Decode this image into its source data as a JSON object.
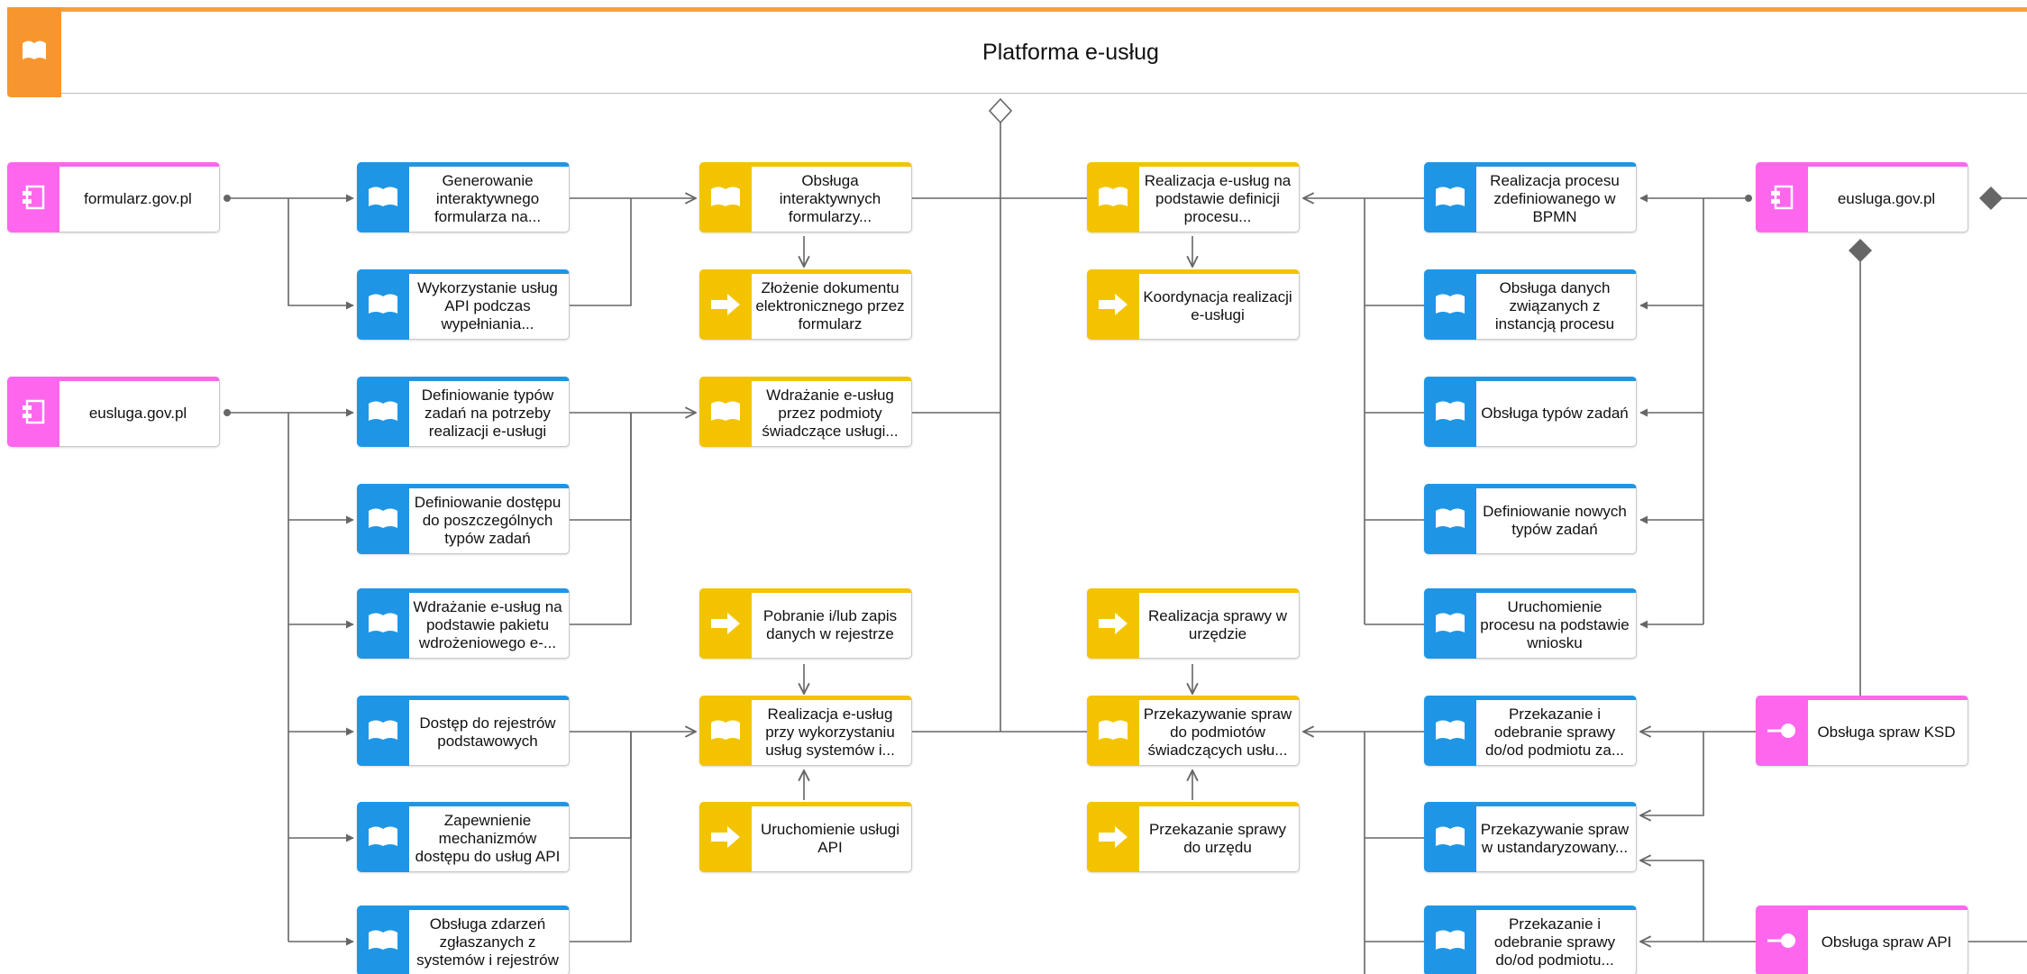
{
  "title": "Platforma e-usług",
  "colors": {
    "header_accent": "#f7962e",
    "service": "#1f96e5",
    "process": "#f3c300",
    "application": "#ff66ee",
    "connector": "#666666"
  },
  "nodes": [
    {
      "id": "app-formularz",
      "label": "formularz.gov.pl",
      "kind": "application",
      "icon": "component-icon"
    },
    {
      "id": "app-eusluga-left",
      "label": "eusluga.gov.pl",
      "kind": "application",
      "icon": "component-icon"
    },
    {
      "id": "svc-generowanie",
      "label": "Generowanie interaktywnego formularza na...",
      "kind": "service",
      "icon": "service-icon"
    },
    {
      "id": "svc-wykorzystanie-api",
      "label": "Wykorzystanie usług API podczas wypełniania...",
      "kind": "service",
      "icon": "service-icon"
    },
    {
      "id": "svc-definiowanie-typow",
      "label": "Definiowanie typów zadań na potrzeby realizacji e-usługi",
      "kind": "service",
      "icon": "service-icon"
    },
    {
      "id": "svc-definiowanie-dostepu",
      "label": "Definiowanie dostępu do poszczególnych typów zadań",
      "kind": "service",
      "icon": "service-icon"
    },
    {
      "id": "svc-wdrazanie-pakietu",
      "label": "Wdrażanie e-usług na podstawie pakietu wdrożeniowego e-...",
      "kind": "service",
      "icon": "service-icon"
    },
    {
      "id": "svc-dostep-rejestrow",
      "label": "Dostęp do rejestrów podstawowych",
      "kind": "service",
      "icon": "service-icon"
    },
    {
      "id": "svc-zapewnienie-api",
      "label": "Zapewnienie mechanizmów dostępu do usług API",
      "kind": "service",
      "icon": "service-icon"
    },
    {
      "id": "svc-obsluga-zdarzen",
      "label": "Obsługa zdarzeń zgłaszanych z systemów i rejestrów",
      "kind": "service",
      "icon": "service-icon"
    },
    {
      "id": "fn-obsluga-formularzy",
      "label": "Obsługa interaktywnych formularzy...",
      "kind": "function",
      "icon": "service-icon"
    },
    {
      "id": "proc-zlozenie",
      "label": "Złożenie dokumentu elektronicznego przez formularz",
      "kind": "process",
      "icon": "arrow-icon"
    },
    {
      "id": "fn-wdrazanie-podmioty",
      "label": "Wdrażanie e-usług przez podmioty świadczące usługi...",
      "kind": "function",
      "icon": "service-icon"
    },
    {
      "id": "proc-pobranie",
      "label": "Pobranie i/lub zapis danych w rejestrze",
      "kind": "process",
      "icon": "arrow-icon"
    },
    {
      "id": "fn-realizacja-api",
      "label": "Realizacja e-usług przy wykorzystaniu usług systemów i...",
      "kind": "function",
      "icon": "service-icon"
    },
    {
      "id": "proc-uruchomienie-api",
      "label": "Uruchomienie usługi API",
      "kind": "process",
      "icon": "arrow-icon"
    },
    {
      "id": "fn-realizacja-definicji",
      "label": "Realizacja e-usług na podstawie definicji procesu...",
      "kind": "function",
      "icon": "service-icon"
    },
    {
      "id": "proc-koordynacja",
      "label": "Koordynacja realizacji e-usługi",
      "kind": "process",
      "icon": "arrow-icon"
    },
    {
      "id": "proc-realizacja-sprawy",
      "label": "Realizacja sprawy w urzędzie",
      "kind": "process",
      "icon": "arrow-icon"
    },
    {
      "id": "fn-przekazywanie-podmiotow",
      "label": "Przekazywanie spraw do podmiotów świadczących usłu...",
      "kind": "function",
      "icon": "service-icon"
    },
    {
      "id": "proc-przekazanie-urzedu",
      "label": "Przekazanie sprawy do urzędu",
      "kind": "process",
      "icon": "arrow-icon"
    },
    {
      "id": "svc-realizacja-bpmn",
      "label": "Realizacja procesu zdefiniowanego w BPMN",
      "kind": "service",
      "icon": "service-icon"
    },
    {
      "id": "svc-obsluga-danych",
      "label": "Obsługa danych związanych z instancją procesu",
      "kind": "service",
      "icon": "service-icon"
    },
    {
      "id": "svc-obsluga-typow",
      "label": "Obsługa typów zadań",
      "kind": "service",
      "icon": "service-icon"
    },
    {
      "id": "svc-definiowanie-nowych",
      "label": "Definiowanie nowych typów zadań",
      "kind": "service",
      "icon": "service-icon"
    },
    {
      "id": "svc-uruchomienie-procesu",
      "label": "Uruchomienie procesu na podstawie wniosku",
      "kind": "service",
      "icon": "service-icon"
    },
    {
      "id": "svc-przekazanie-za",
      "label": "Przekazanie i odebranie sprawy do/od podmiotu za...",
      "kind": "service",
      "icon": "service-icon"
    },
    {
      "id": "svc-przekazywanie-ustand",
      "label": "Przekazywanie spraw w ustandaryzowany...",
      "kind": "service",
      "icon": "service-icon"
    },
    {
      "id": "svc-przekazanie-podmiotu",
      "label": "Przekazanie i odebranie sprawy do/od podmiotu...",
      "kind": "service",
      "icon": "service-icon"
    },
    {
      "id": "app-eusluga-right",
      "label": "eusluga.gov.pl",
      "kind": "application",
      "icon": "component-icon"
    },
    {
      "id": "iface-ksd",
      "label": "Obsługa spraw KSD",
      "kind": "interface",
      "icon": "interface-icon"
    },
    {
      "id": "iface-api",
      "label": "Obsługa spraw API",
      "kind": "interface",
      "icon": "interface-icon"
    }
  ]
}
